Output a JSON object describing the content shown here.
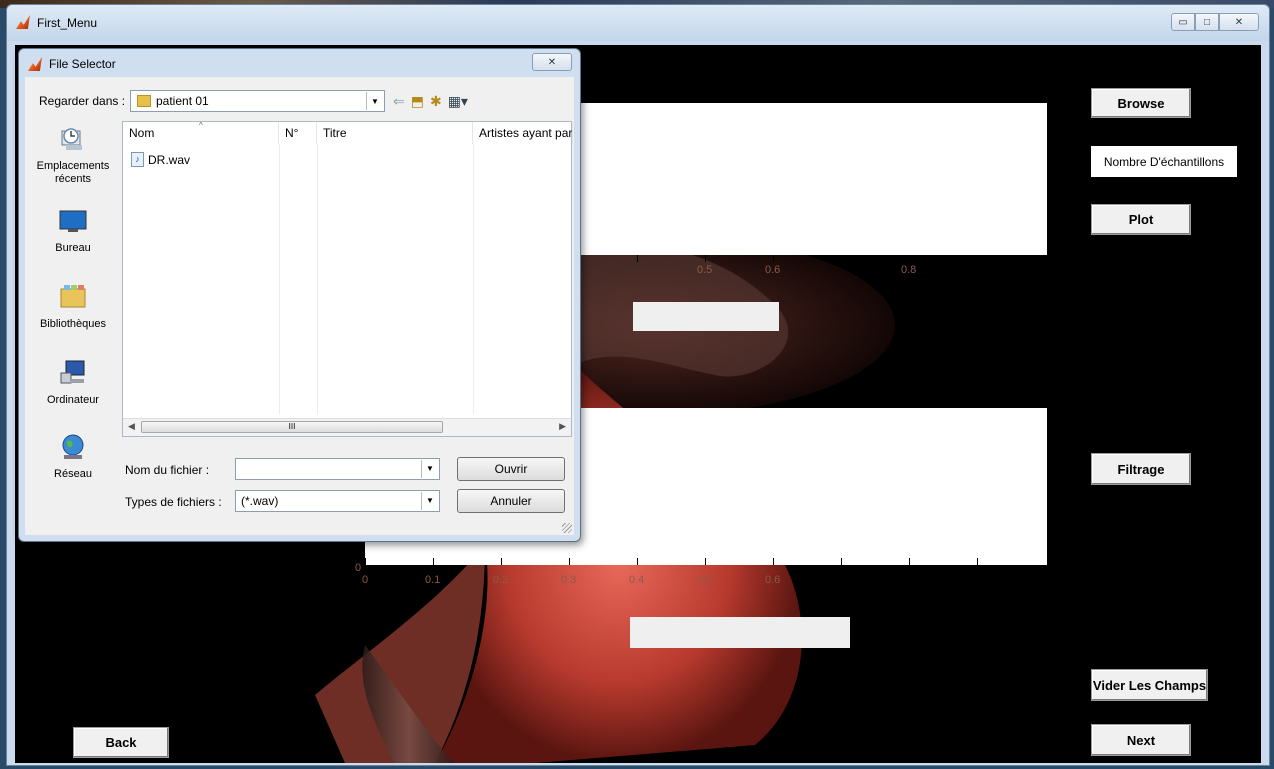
{
  "window": {
    "title": "First_Menu"
  },
  "figure": {
    "buttons": {
      "browse": "Browse",
      "plot": "Plot",
      "filtrage": "Filtrage",
      "vider": "Vider Les Champs",
      "next": "Next",
      "back": "Back"
    },
    "samples_text": "Nombre D'échantillons",
    "axes1_ticks": [
      "0.5",
      "0.6",
      "0.8"
    ],
    "axes2_ticks": [
      "0",
      "0.1",
      "0.2",
      "0.3",
      "0.4",
      "0.5",
      "0.6"
    ],
    "axes2_ylabel": "0"
  },
  "dialog": {
    "title": "File Selector",
    "look_in_label": "Regarder dans :",
    "look_in_value": "patient 01",
    "places": [
      "Emplacements récents",
      "Bureau",
      "Bibliothèques",
      "Ordinateur",
      "Réseau"
    ],
    "columns": [
      "Nom",
      "N°",
      "Titre",
      "Artistes ayant par"
    ],
    "files": [
      "DR.wav"
    ],
    "filename_label": "Nom du fichier :",
    "filename_value": "",
    "filetype_label": "Types de fichiers :",
    "filetype_value": "(*.wav)",
    "open_button": "Ouvrir",
    "cancel_button": "Annuler",
    "scroll_thumb_glyph": "III"
  },
  "colors": {
    "figure_bg": "#000000",
    "window_frame": "#c9dbec",
    "tick_label": "#8a5a4a"
  }
}
